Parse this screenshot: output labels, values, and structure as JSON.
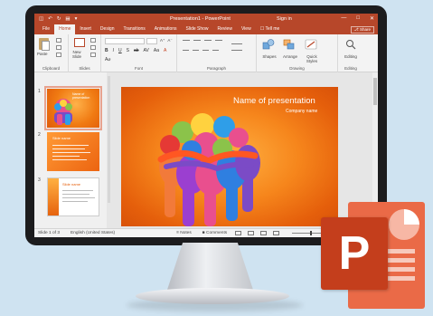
{
  "window": {
    "title": "Presentation1 - PowerPoint",
    "signin": "Sign in",
    "min_glyph": "—",
    "max_glyph": "□",
    "close_glyph": "✕"
  },
  "ribbon_tabs": [
    "File",
    "Home",
    "Insert",
    "Design",
    "Transitions",
    "Animations",
    "Slide Show",
    "Review",
    "View",
    "☐ Tell me"
  ],
  "share": "⎇ Share",
  "ribbon": {
    "groups": [
      "Clipboard",
      "Slides",
      "Font",
      "Paragraph",
      "Drawing",
      "Editing"
    ],
    "paste": "Paste",
    "new_slide": "New\nSlide",
    "shapes": "Shapes",
    "arrange": "Arrange",
    "quick_styles": "Quick\nStyles",
    "editing": "Editing",
    "font_row1": [
      "B",
      "I",
      "U",
      "S",
      "ab",
      "AV",
      "Aa",
      "A"
    ],
    "font_row2": [
      "A⁺",
      "A⁻",
      "A⌀"
    ]
  },
  "thumbnails": [
    {
      "num": "1",
      "title": "Name of presentation"
    },
    {
      "num": "2",
      "title": "Slide name"
    },
    {
      "num": "3",
      "title": "Slide name"
    }
  ],
  "slide": {
    "title": "Name of presentation",
    "subtitle": "Company name"
  },
  "status": {
    "slide": "Slide 1 of 3",
    "language": "English (United States)",
    "notes": "≡ Notes",
    "comments": "■ Comments"
  },
  "colors": {
    "accent": "#b7472a",
    "slide_bg": "#f6861c",
    "logo": "#c43e1c"
  }
}
